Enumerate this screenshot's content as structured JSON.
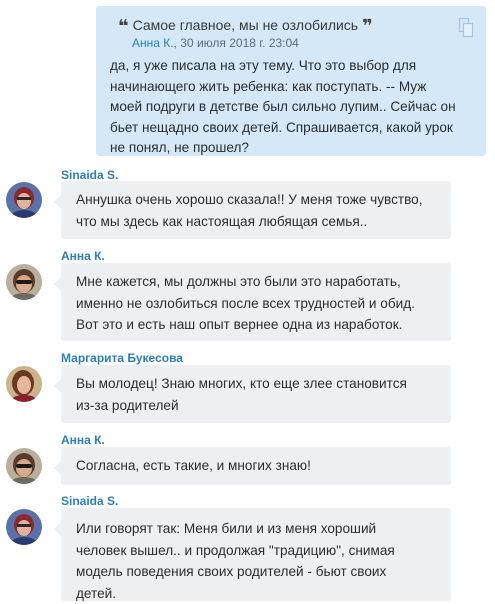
{
  "quote": {
    "header": "Самое главное, мы не озлобились",
    "author": "Анна К.",
    "date": ", 30 июля 2018 г. 23:04",
    "lines": [
      "да, я уже писала на эту тему. Что это выбор для",
      "начинающего жить ребенка: как поступать.  -- Муж",
      "моей подруги в детстве был сильно лупим.. Сейчас он",
      "бьет нещадно своих детей. Спрашивается, какой урок",
      "не понял, не прошел?"
    ]
  },
  "posts": [
    {
      "author": "Sinaida S.",
      "lines": [
        "Аннушка очень хорошо сказала!! У меня тоже чувство,",
        "что мы здесь как настоящая любящая семья.."
      ]
    },
    {
      "author": "Анна К.",
      "lines": [
        "Мне кажется, мы должны это были это наработать,",
        "именно не озлобиться после всех трудностей и обид.",
        "Вот это и есть наш опыт вернее одна из наработок."
      ]
    },
    {
      "author": "Маргарита Букесова",
      "lines": [
        "Вы молодец! Знаю многих, кто еще злее становится",
        "из-за родителей"
      ]
    },
    {
      "author": "Анна К.",
      "lines": [
        "Согласна, есть такие, и многих знаю!"
      ]
    },
    {
      "author": "Sinaida S.",
      "lines": [
        "Или говорят так: Меня били и из меня хороший",
        "человек вышел.. и продолжая \"традицию\", снимая",
        "модель поведения своих родителей - бьют своих",
        "детей."
      ]
    }
  ]
}
